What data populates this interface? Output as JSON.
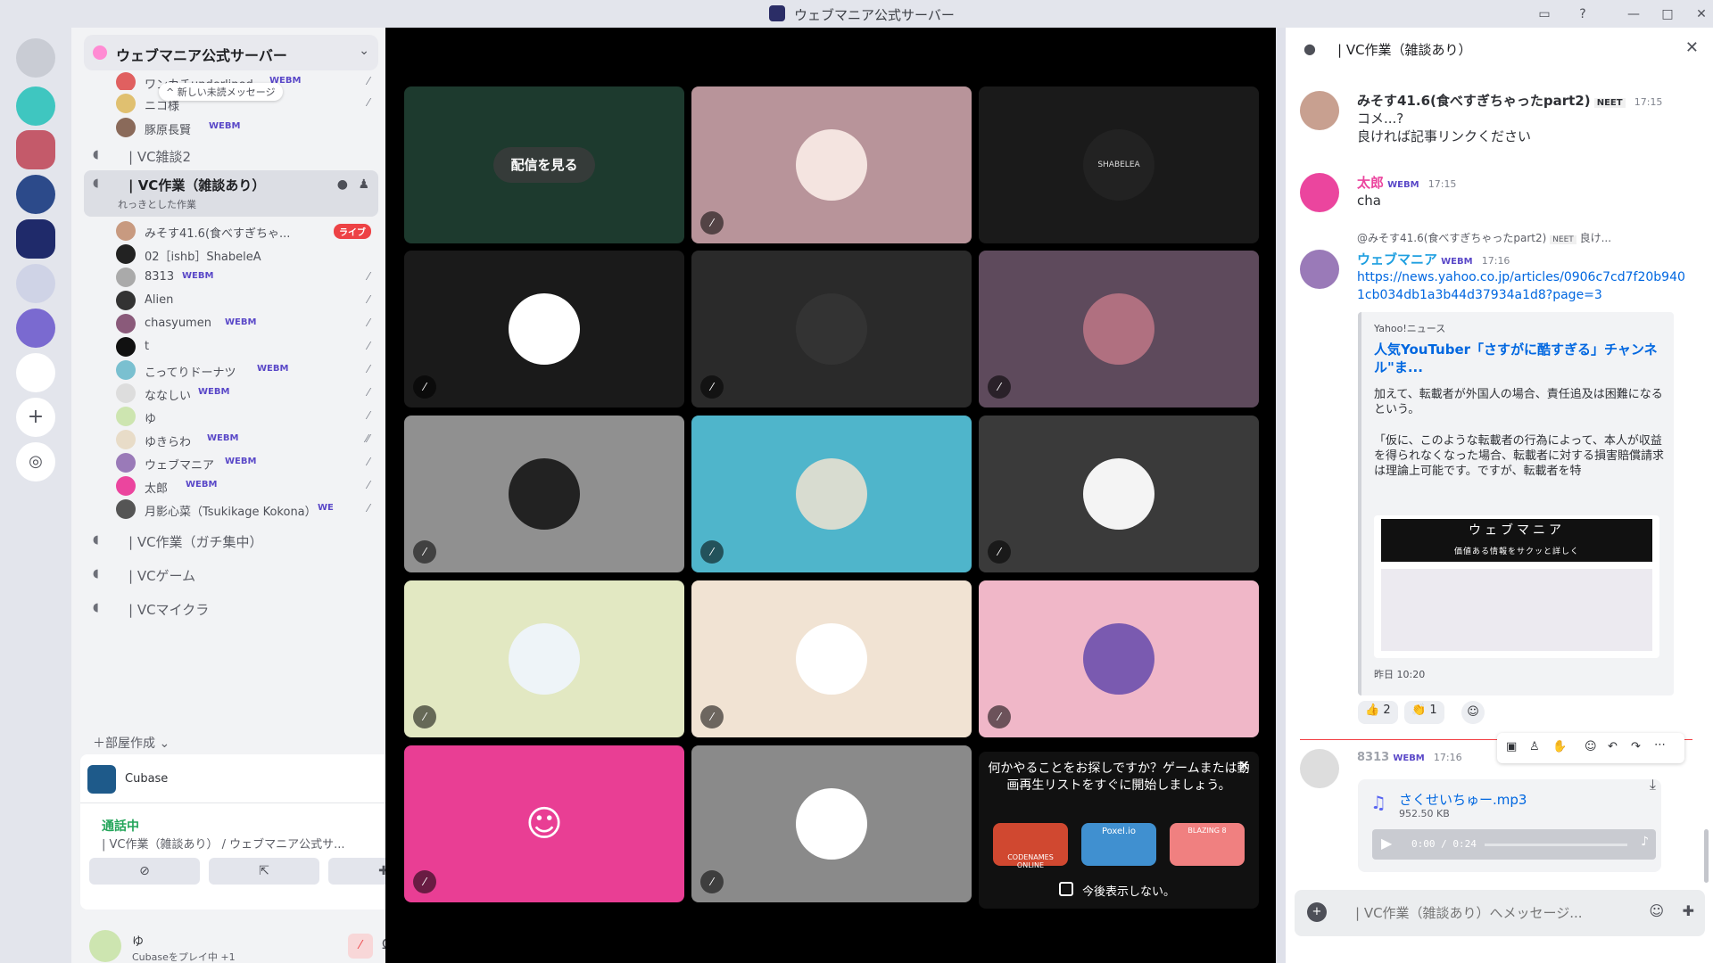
{
  "window": {
    "title": "ウェブマニア公式サーバー"
  },
  "guild": {
    "name": "ウェブマニア公式サーバー",
    "toast": "新しい未読メッセージ"
  },
  "channels": {
    "vc_chat2": "| VC雑談2",
    "vc_work": "| VC作業（雑談あり）",
    "vc_work_sub": "れっきとした作業",
    "vc_focus": "| VC作業（ガチ集中）",
    "vc_game": "| VCゲーム",
    "vc_mc": "| VCマイクラ",
    "create": "部屋作成"
  },
  "top_members": [
    {
      "name": "ワンカチunderlined",
      "tag": "WEBM"
    },
    {
      "name": "ニコ様"
    },
    {
      "name": "豚原長賢",
      "tag": "WEBM"
    }
  ],
  "members": [
    {
      "name": "みそす41.6(食べすぎちゃ...",
      "live": "ライブ"
    },
    {
      "name": "02［ishb］ShabeleA"
    },
    {
      "name": "8313",
      "tag": "WEBM"
    },
    {
      "name": "Alien"
    },
    {
      "name": "chasyumen",
      "tag": "WEBM"
    },
    {
      "name": "t"
    },
    {
      "name": "こってりドーナツ",
      "tag": "WEBM"
    },
    {
      "name": "ななしい",
      "tag": "WEBM"
    },
    {
      "name": "ゆ"
    },
    {
      "name": "ゆきらわ",
      "tag": "WEBM"
    },
    {
      "name": "ウェブマニア",
      "tag": "WEBM"
    },
    {
      "name": "太郎",
      "tag": "WEBM"
    },
    {
      "name": "月影心菜（Tsukikage Kokona）",
      "tag": "WE"
    }
  ],
  "voice": {
    "app": "Cubase",
    "status": "通話中",
    "channel": "| VC作業（雑談あり） / ウェブマニア公式サ..."
  },
  "user": {
    "name": "ゆ",
    "activity": "Cubaseをプレイ中 +1"
  },
  "stage": {
    "watch_label": "配信を見る",
    "shabelea_label": "SHABELEA",
    "activity_text": "何かやることをお探しですか？ゲームまたは動画再生リストをすぐに開始しましょう。",
    "dont_show": "今後表示しない。",
    "games": [
      "CODENAMES ONLINE",
      "Poxel.io",
      "BLAZING 8"
    ],
    "tile_colors": [
      "#1d3a2e",
      "#b8949a",
      "#1a1a1a",
      "#1a1a1a",
      "#2a2a2a",
      "#5e4a5c",
      "#909090",
      "#4fb5cb",
      "#3a3a3a",
      "#e2e8c2",
      "#f1e3d3",
      "#f0b7c8",
      "#e93e94",
      "#8a8a8a"
    ]
  },
  "chat": {
    "header": "| VC作業（雑談あり）",
    "m1": {
      "name": "みそす41.6(食べすぎちゃったpart2)",
      "badge": "NEET",
      "time": "17:15",
      "lines": [
        "コメ...?",
        "良ければ記事リンクください"
      ]
    },
    "m2": {
      "name": "太郎",
      "tag": "WEBM",
      "time": "17:15",
      "text": "cha"
    },
    "m3": {
      "reply": "@みそす41.6(食べすぎちゃったpart2)",
      "reply_badge": "NEET",
      "reply_tail": "良け...",
      "name": "ウェブマニア",
      "tag": "WEBM",
      "time": "17:16",
      "link": "https://news.yahoo.co.jp/articles/0906c7cd7f20b9401cb034db1a3b44d37934a1d8?page=3"
    },
    "embed": {
      "provider": "Yahoo!ニュース",
      "title": "人気YouTuber「さすがに酷すぎる」チャンネル\"ま...",
      "p1": "加えて、転載者が外国人の場合、責任追及は困難になるという。",
      "p2": "「仮に、このような転載者の行為によって、本人が収益を得られなくなった場合、転載者に対する損害賠償請求は理論上可能です。ですが、転載者を特",
      "banner": "ウェブマニア",
      "banner_sub": "価値ある情報をサクッと詳しく",
      "footer": "昨日 10:20"
    },
    "reactions": [
      {
        "emoji": "👍",
        "count": "2"
      },
      {
        "emoji": "👏",
        "count": "1"
      }
    ],
    "m4": {
      "name": "8313",
      "tag": "WEBM",
      "time": "17:16"
    },
    "file": {
      "name": "さくせいちゅー.mp3",
      "size": "952.50 KB",
      "time": "0:00 / 0:24"
    },
    "composer_placeholder": "| VC作業（雑談あり）へメッセージ..."
  }
}
